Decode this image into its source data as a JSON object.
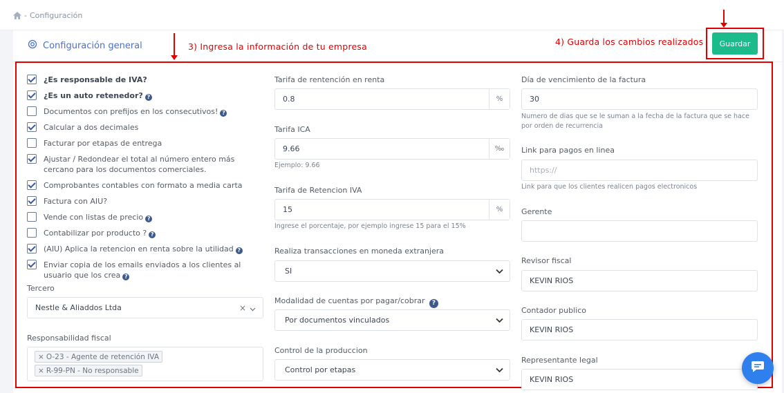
{
  "breadcrumb": {
    "separator": "-",
    "current": "Configuración"
  },
  "card": {
    "title": "Configuración general"
  },
  "annotations": {
    "step3": "3) Ingresa la información de tu empresa",
    "step4": "4) Guarda los cambios realizados"
  },
  "save_button": {
    "label": "Guardar"
  },
  "checkboxes": [
    {
      "label": "¿Es responsable de IVA?",
      "checked": true,
      "bold": true,
      "help": false
    },
    {
      "label": "¿Es un auto retenedor?",
      "checked": true,
      "bold": true,
      "help": true
    },
    {
      "label": "Documentos con prefijos en los consecutivos!",
      "checked": false,
      "bold": false,
      "help": true
    },
    {
      "label": "Calcular a dos decimales",
      "checked": true,
      "bold": false,
      "help": false
    },
    {
      "label": "Facturar por etapas de entrega",
      "checked": false,
      "bold": false,
      "help": false
    },
    {
      "label": "Ajustar / Redondear el total al número entero más cercano para los documentos comerciales.",
      "checked": true,
      "bold": false,
      "help": false
    },
    {
      "label": "Comprobantes contables con formato a media carta",
      "checked": true,
      "bold": false,
      "help": false
    },
    {
      "label": " Factura con AIU?",
      "checked": true,
      "bold": false,
      "help": false
    },
    {
      "label": "Vende con listas de precio",
      "checked": false,
      "bold": false,
      "help": true
    },
    {
      "label": "Contabilizar por producto ?",
      "checked": false,
      "bold": false,
      "help": true
    },
    {
      "label": "(AIU) Aplica la retencion en renta sobre la utilidad",
      "checked": true,
      "bold": false,
      "help": true
    },
    {
      "label": "Enviar copia de los emails enviados a los clientes al usuario que los crea",
      "checked": true,
      "bold": false,
      "help": true
    }
  ],
  "tercero": {
    "label": "Tercero",
    "value": "Nestle & Aliaddos Ltda"
  },
  "responsabilidad": {
    "label": "Responsabilidad fiscal",
    "tags": [
      "O-23 - Agente de retención IVA",
      "R-99-PN - No responsable"
    ]
  },
  "tarifa_renta": {
    "label": "Tarifa de rentención en renta",
    "value": "0.8",
    "addon": "%"
  },
  "tarifa_ica": {
    "label": "Tarifa ICA",
    "value": "9.66",
    "addon": "‰",
    "help": "Ejemplo: 9.66"
  },
  "tarifa_iva": {
    "label": "Tarifa de Retencion IVA",
    "value": "15",
    "addon": "%",
    "help": "Ingrese el porcentaje, por ejemplo ingrese 15 para el 15%"
  },
  "moneda_ext": {
    "label": "Realiza transacciones en moneda extranjera",
    "value": "SI"
  },
  "modalidad": {
    "label": "Modalidad de cuentas por pagar/cobrar",
    "value": "Por documentos vinculados"
  },
  "produccion": {
    "label": "Control de la produccion",
    "value": "Control por etapas"
  },
  "dia_venc": {
    "label": "Día de vencimiento de la factura",
    "value": "30",
    "help": "Numero de dias que se le suman a la fecha de la factura que se hace por orden de recurrencia"
  },
  "link_pagos": {
    "label": "Link para pagos en linea",
    "placeholder": "https://",
    "help": "Link para que los clientes realicen pagos electronicos"
  },
  "gerente": {
    "label": "Gerente",
    "value": ""
  },
  "revisor": {
    "label": "Revisor fiscal",
    "value": "KEVIN RIOS"
  },
  "contador": {
    "label": "Contador publico",
    "value": "KEVIN RIOS"
  },
  "representante": {
    "label": "Representante legal",
    "value": "KEVIN RIOS"
  },
  "colors": {
    "accent": "#4a6fd1",
    "success": "#1cbb8c",
    "annotation": "#e00000",
    "chat": "#2f80ed"
  },
  "icons": [
    "home-icon",
    "settings-gear-icon",
    "help-question-icon",
    "chevron-down-icon",
    "clear-x-icon",
    "chat-bubble-icon"
  ]
}
